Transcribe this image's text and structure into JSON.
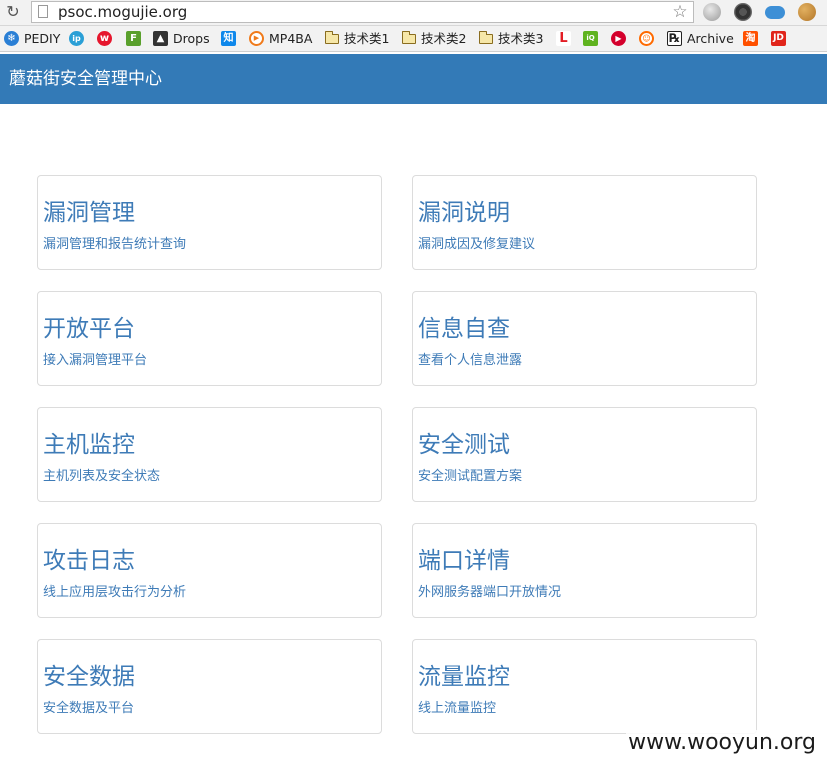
{
  "browser": {
    "url": "psoc.mogujie.org",
    "bookmarks": [
      {
        "label": "PEDIY",
        "icon": "snowflake-icon",
        "color": "#2a7fd5"
      },
      {
        "label": "",
        "icon": "ip-icon",
        "color": "#2a9fd6"
      },
      {
        "label": "",
        "icon": "weibo-icon",
        "color": "#e6162d"
      },
      {
        "label": "",
        "icon": "f-icon",
        "color": "#5aa02c"
      },
      {
        "label": "Drops",
        "icon": "drops-icon",
        "color": "#333333"
      },
      {
        "label": "",
        "icon": "zhihu-icon",
        "color": "#0f88eb"
      },
      {
        "label": "MP4BA",
        "icon": "mp4ba-icon",
        "color": "#f07a1a"
      },
      {
        "label": "技术类1",
        "icon": "folder-icon",
        "color": "#f6e7a8"
      },
      {
        "label": "技术类2",
        "icon": "folder-icon",
        "color": "#f6e7a8"
      },
      {
        "label": "技术类3",
        "icon": "folder-icon",
        "color": "#f6e7a8"
      },
      {
        "label": "",
        "icon": "letv-icon",
        "color": "#e31c24"
      },
      {
        "label": "",
        "icon": "iqiyi-icon",
        "color": "#5fb31f"
      },
      {
        "label": "",
        "icon": "youku-icon",
        "color": "#d4002c"
      },
      {
        "label": "",
        "icon": "smiley-icon",
        "color": "#ff6a00"
      },
      {
        "label": "Archive",
        "icon": "archive-icon",
        "color": "#333333"
      },
      {
        "label": "",
        "icon": "taobao-icon",
        "color": "#ff5000"
      },
      {
        "label": "JD",
        "icon": "jd-icon",
        "color": "#e1251b"
      }
    ]
  },
  "app": {
    "title": "蘑菇街安全管理中心",
    "header_color": "#337ab7"
  },
  "cards": [
    {
      "title": "漏洞管理",
      "desc": "漏洞管理和报告统计查询"
    },
    {
      "title": "漏洞说明",
      "desc": "漏洞成因及修复建议"
    },
    {
      "title": "开放平台",
      "desc": "接入漏洞管理平台"
    },
    {
      "title": "信息自查",
      "desc": "查看个人信息泄露"
    },
    {
      "title": "主机监控",
      "desc": "主机列表及安全状态"
    },
    {
      "title": "安全测试",
      "desc": "安全测试配置方案"
    },
    {
      "title": "攻击日志",
      "desc": "线上应用层攻击行为分析"
    },
    {
      "title": "端口详情",
      "desc": "外网服务器端口开放情况"
    },
    {
      "title": "安全数据",
      "desc": "安全数据及平台"
    },
    {
      "title": "流量监控",
      "desc": "线上流量监控"
    }
  ],
  "watermark": "www.wooyun.org"
}
